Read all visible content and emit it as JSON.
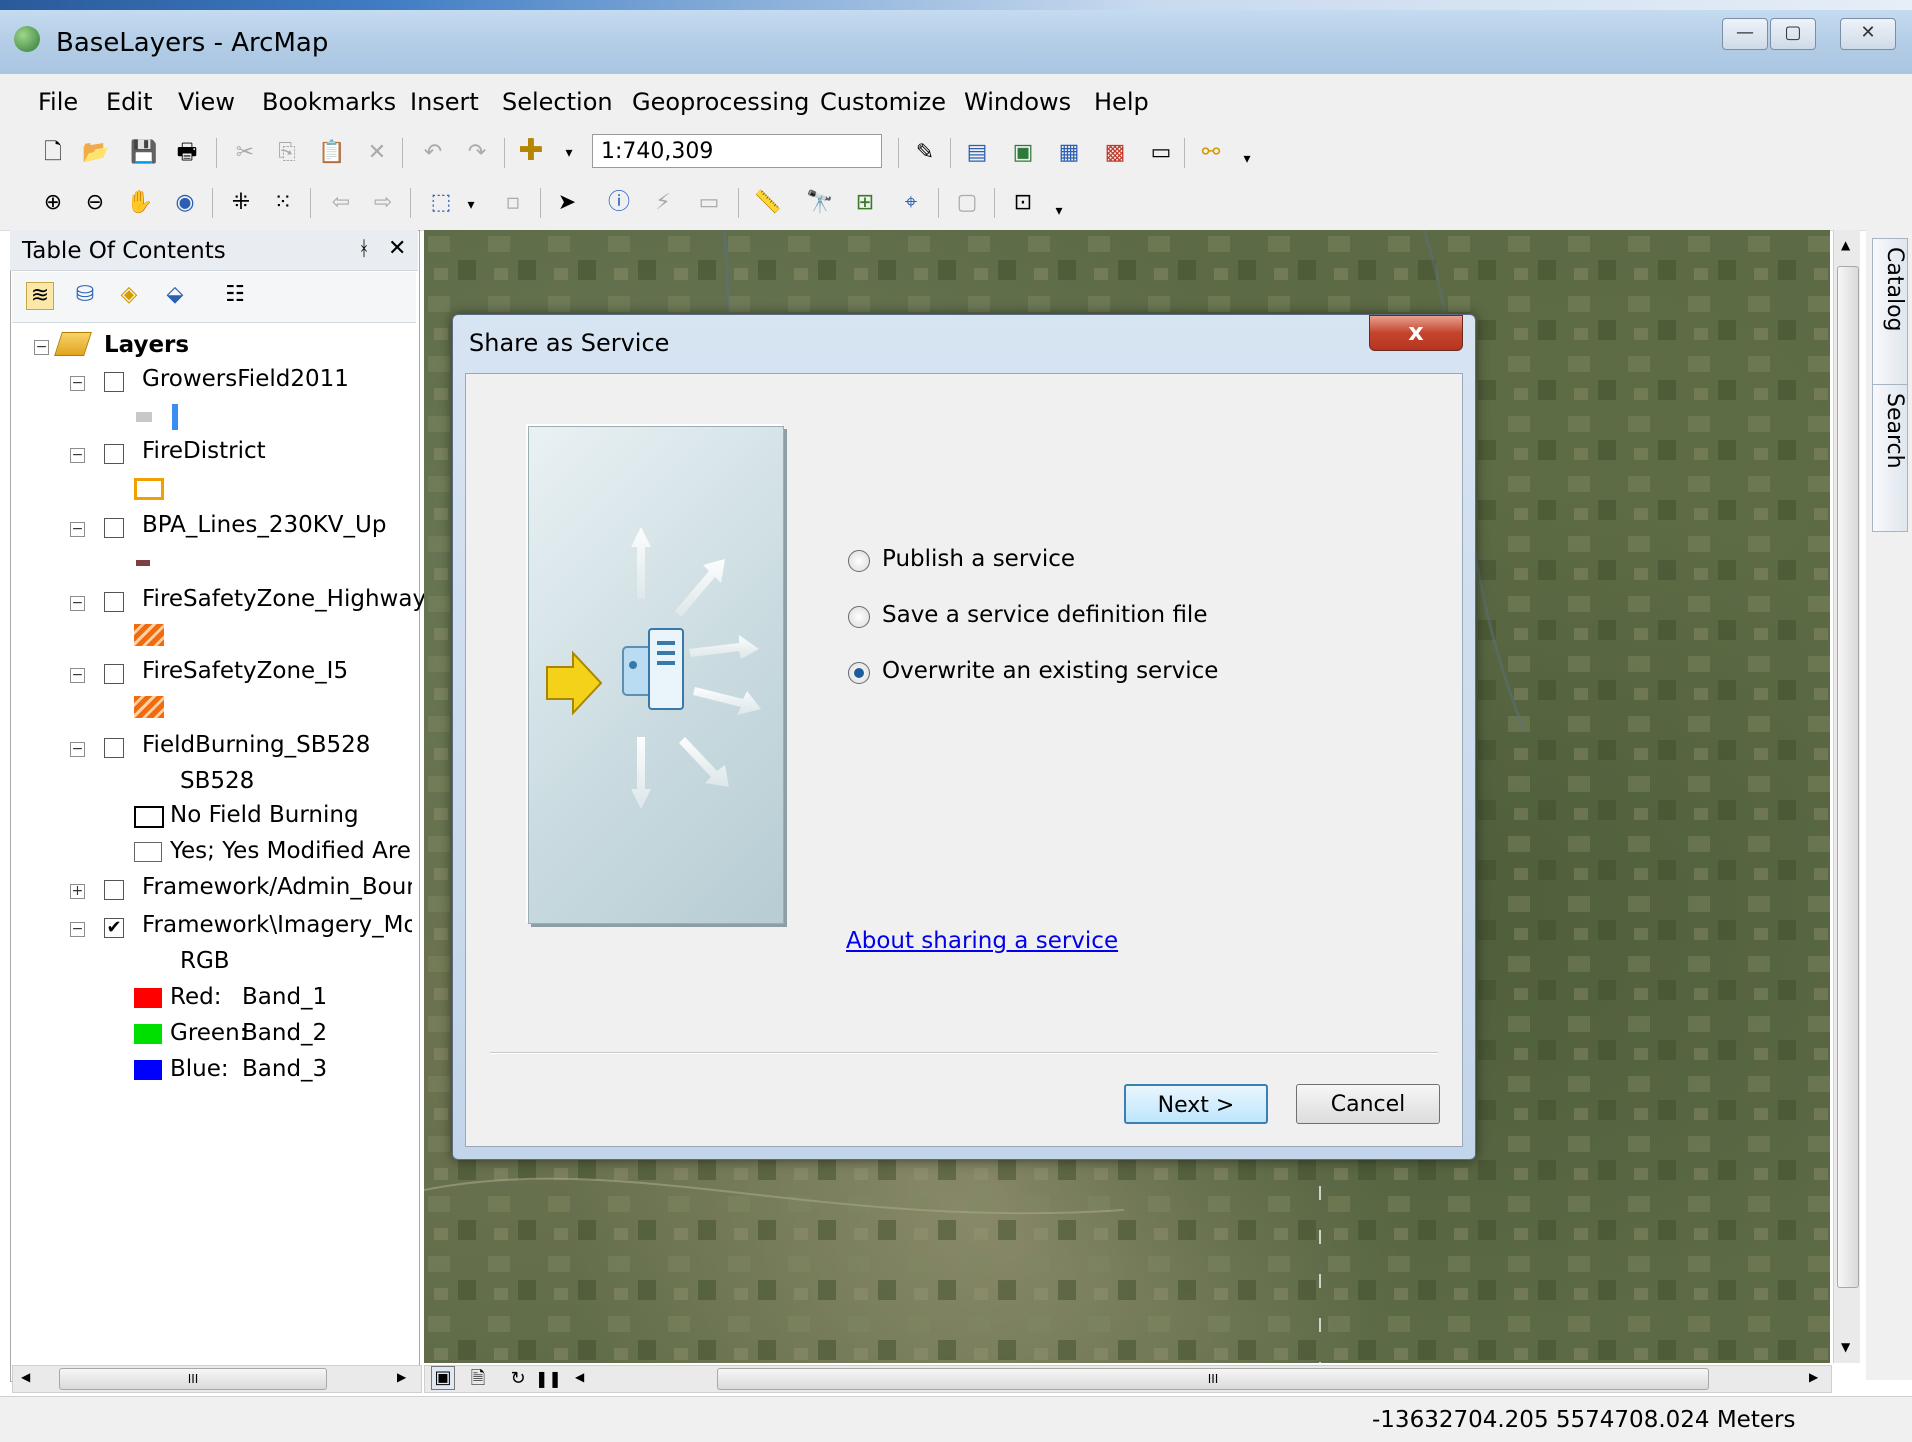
{
  "window": {
    "title": "BaseLayers - ArcMap",
    "buttons": {
      "minimize": "—",
      "maximize": "▢",
      "close": "✕"
    }
  },
  "menu": [
    "File",
    "Edit",
    "View",
    "Bookmarks",
    "Insert",
    "Selection",
    "Geoprocessing",
    "Customize",
    "Windows",
    "Help"
  ],
  "toolbar": {
    "scale": "1:740,309"
  },
  "toc": {
    "title": "Table Of Contents",
    "pin": "ᚼ",
    "close": "✕",
    "root": "Layers",
    "layers": [
      {
        "name": "GrowersField2011",
        "checked": false
      },
      {
        "name": "FireDistrict",
        "checked": false
      },
      {
        "name": "BPA_Lines_230KV_Up",
        "checked": false
      },
      {
        "name": "FireSafetyZone_Highway",
        "checked": false
      },
      {
        "name": "FireSafetyZone_I5",
        "checked": false
      },
      {
        "name": "FieldBurning_SB528",
        "checked": false
      },
      {
        "name": "Framework/Admin_Boun",
        "checked": false
      },
      {
        "name": "Framework\\Imagery_Mos",
        "checked": true
      }
    ],
    "sb528": {
      "field": "SB528",
      "classes": [
        "No Field Burning",
        "Yes; Yes Modified Area"
      ]
    },
    "rgb": {
      "label": "RGB",
      "bands": [
        {
          "label": "Red:",
          "band": "Band_1",
          "color": "#ff0000"
        },
        {
          "label": "Green:",
          "band": "Band_2",
          "color": "#00e000"
        },
        {
          "label": "Blue:",
          "band": "Band_3",
          "color": "#0000ff"
        }
      ]
    }
  },
  "side_tabs": {
    "catalog": "Catalog",
    "search": "Search"
  },
  "dialog": {
    "title": "Share as Service",
    "close": "x",
    "options": [
      {
        "label": "Publish a service",
        "selected": false
      },
      {
        "label": "Save a service definition file",
        "selected": false
      },
      {
        "label": "Overwrite an existing service",
        "selected": true
      }
    ],
    "link": "About sharing a service",
    "next": "Next >",
    "cancel": "Cancel"
  },
  "status": {
    "coordinates": "-13632704.205  5574708.024 Meters"
  },
  "scrollbar_grip": "III"
}
